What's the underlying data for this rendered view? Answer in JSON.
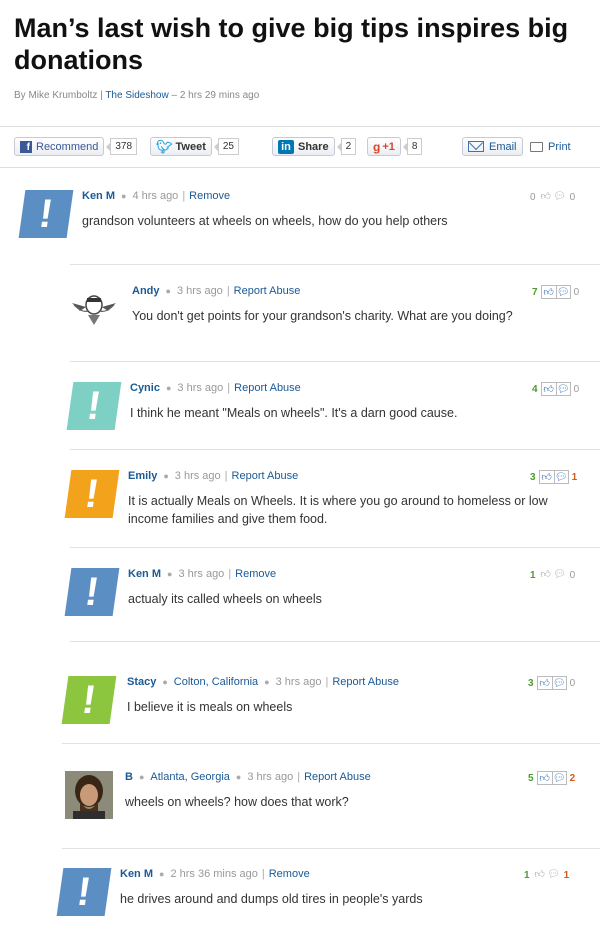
{
  "article": {
    "title": "Man’s last wish to give big tips inspires big donations",
    "byline_prefix": "By Mike Krumboltz | ",
    "byline_source": "The Sideshow",
    "byline_time": " – 2 hrs 29 mins ago"
  },
  "share": {
    "recommend": "Recommend",
    "recommend_count": "378",
    "tweet": "Tweet",
    "tweet_count": "25",
    "share": "Share",
    "share_count": "2",
    "gplus": "+1",
    "gplus_count": "8",
    "email": "Email",
    "print": "Print"
  },
  "comment_actions": {
    "remove": "Remove",
    "report": "Report Abuse"
  },
  "comments": [
    {
      "author": "Ken M",
      "location": "",
      "time": "4 hrs ago",
      "action": "Remove",
      "text": "grandson volunteers at wheels on wheels, how do you help others",
      "up": "0",
      "down": "0",
      "avatar_color": "#5b8fc4"
    },
    {
      "author": "Andy",
      "location": "",
      "time": "3 hrs ago",
      "action": "Report Abuse",
      "text": "You don't get points for your grandson's charity. What are you doing?",
      "up": "7",
      "down": "0",
      "avatar_color": "#ffffff"
    },
    {
      "author": "Cynic",
      "location": "",
      "time": "3 hrs ago",
      "action": "Report Abuse",
      "text": "I think he meant \"Meals on wheels\". It's a darn good cause.",
      "up": "4",
      "down": "0",
      "avatar_color": "#7fd0c4"
    },
    {
      "author": "Emily",
      "location": "",
      "time": "3 hrs ago",
      "action": "Report Abuse",
      "text": "It is actually Meals on Wheels. It is where you go around to homeless or low income families and give them food.",
      "up": "3",
      "down": "1",
      "avatar_color": "#f3a21b"
    },
    {
      "author": "Ken M",
      "location": "",
      "time": "3 hrs ago",
      "action": "Remove",
      "text": "actualy its called wheels on wheels",
      "up": "1",
      "down": "0",
      "avatar_color": "#5b8fc4"
    },
    {
      "author": "Stacy",
      "location": "Colton, California",
      "time": "3 hrs ago",
      "action": "Report Abuse",
      "text": "I believe it is meals on wheels",
      "up": "3",
      "down": "0",
      "avatar_color": "#8cc63f"
    },
    {
      "author": "B",
      "location": "Atlanta, Georgia",
      "time": "3 hrs ago",
      "action": "Report Abuse",
      "text": "wheels on wheels? how does that work?",
      "up": "5",
      "down": "2",
      "avatar_color": "#6b4a34"
    },
    {
      "author": "Ken M",
      "location": "",
      "time": "2 hrs 36 mins ago",
      "action": "Remove",
      "text": "he drives around and dumps old tires in people's yards",
      "up": "1",
      "down": "1",
      "avatar_color": "#5b8fc4"
    }
  ],
  "icons": {
    "thumb_up": "thumbs-up-icon",
    "thumb_down": "thumbs-down-icon"
  }
}
